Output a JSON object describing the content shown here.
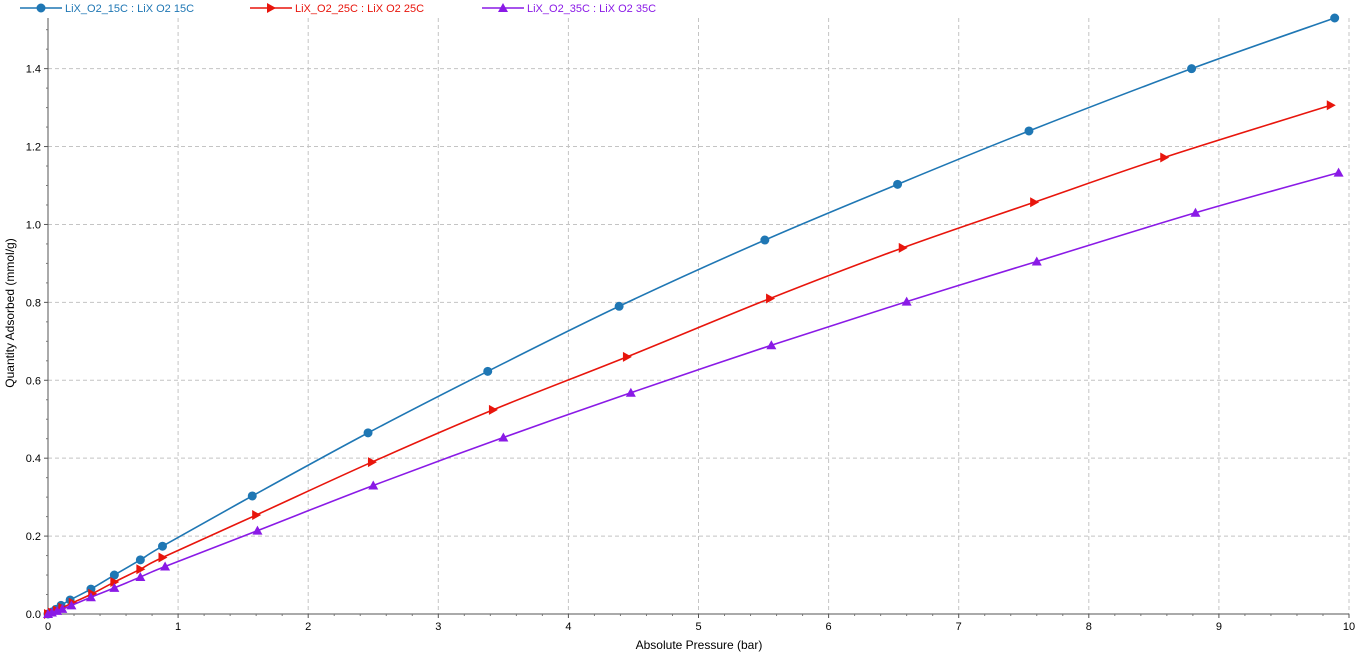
{
  "chart_data": {
    "type": "line",
    "title": "",
    "xlabel": "Absolute Pressure (bar)",
    "ylabel": "Quantity Adsorbed (mmol/g)",
    "xlim": [
      0,
      10
    ],
    "ylim": [
      0,
      1.53
    ],
    "xticks": [
      0,
      1,
      2,
      3,
      4,
      5,
      6,
      7,
      8,
      9,
      10
    ],
    "yticks": [
      0.0,
      0.2,
      0.4,
      0.6,
      0.8,
      1.0,
      1.2,
      1.4
    ],
    "xtick_labels": [
      "0",
      "1",
      "2",
      "3",
      "4",
      "5",
      "6",
      "7",
      "8",
      "9",
      "10"
    ],
    "ytick_labels": [
      "0.0",
      "0.2",
      "0.4",
      "0.6",
      "0.8",
      "1.0",
      "1.2",
      "1.4"
    ],
    "grid": true,
    "legend_position": "top-left",
    "series": [
      {
        "name": "LiX_O2_15C : LiX O2 15C",
        "color": "#1f77b4",
        "marker": "circle",
        "x": [
          0.0,
          0.03,
          0.06,
          0.1,
          0.17,
          0.33,
          0.51,
          0.71,
          0.88,
          1.57,
          2.46,
          3.38,
          4.39,
          5.51,
          6.53,
          7.54,
          8.79,
          9.89
        ],
        "y": [
          0.0,
          0.005,
          0.012,
          0.022,
          0.036,
          0.064,
          0.1,
          0.139,
          0.174,
          0.303,
          0.465,
          0.623,
          0.79,
          0.96,
          1.103,
          1.24,
          1.4,
          1.53
        ]
      },
      {
        "name": "LiX_O2_25C : LiX O2 25C",
        "color": "#e8150c",
        "marker": "triangle-right",
        "x": [
          0.0,
          0.03,
          0.07,
          0.11,
          0.19,
          0.34,
          0.51,
          0.71,
          0.88,
          1.6,
          2.49,
          3.42,
          4.45,
          5.55,
          6.57,
          7.58,
          8.58,
          9.86
        ],
        "y": [
          0.0,
          0.004,
          0.009,
          0.016,
          0.029,
          0.052,
          0.082,
          0.115,
          0.145,
          0.254,
          0.39,
          0.524,
          0.66,
          0.81,
          0.94,
          1.057,
          1.172,
          1.306
        ]
      },
      {
        "name": "LiX_O2_35C : LiX O2 35C",
        "color": "#8a1ae6",
        "marker": "triangle-up",
        "x": [
          0.0,
          0.03,
          0.07,
          0.11,
          0.18,
          0.33,
          0.51,
          0.71,
          0.9,
          1.61,
          2.5,
          3.5,
          4.48,
          5.56,
          6.6,
          7.6,
          8.82,
          9.92
        ],
        "y": [
          0.0,
          0.004,
          0.008,
          0.013,
          0.022,
          0.043,
          0.067,
          0.095,
          0.122,
          0.214,
          0.33,
          0.453,
          0.568,
          0.69,
          0.802,
          0.905,
          1.03,
          1.133
        ]
      }
    ]
  }
}
